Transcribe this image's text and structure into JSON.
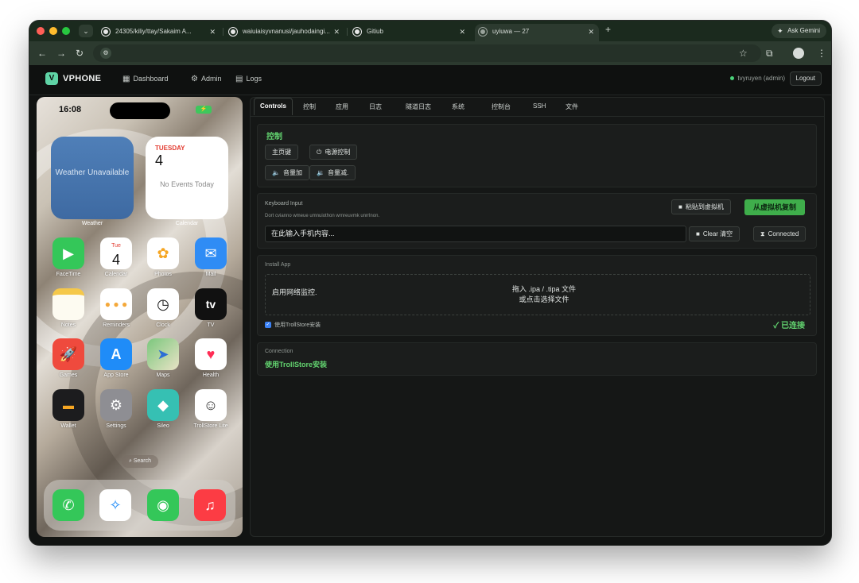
{
  "browser": {
    "tabs": [
      {
        "title": "24305/kiliy/ttay/Sakaim A..."
      },
      {
        "title": "waiuiaisyvnanusi/jauhodaingi..."
      },
      {
        "title": "Gitiub"
      },
      {
        "title": "uyiuwa — 27"
      }
    ],
    "new_tab": "+",
    "ask_gemini": "Ask Gemini"
  },
  "app": {
    "brand": "VPHONE",
    "nav": [
      {
        "label": "Dashboard",
        "icon": "dashboard-icon"
      },
      {
        "label": "Admin",
        "icon": "gear-icon"
      },
      {
        "label": "Logs",
        "icon": "document-icon"
      }
    ],
    "user": "tvyruyen (admin)",
    "logout": "Logout"
  },
  "phone": {
    "time": "16:08",
    "weather_widget": "Weather Unavailable",
    "weather_label": "Weather",
    "calendar_day": "TUESDAY",
    "calendar_date": "4",
    "calendar_events": "No Events Today",
    "calendar_label": "Calendar",
    "apps": [
      {
        "label": "FaceTime",
        "color": "#34c759"
      },
      {
        "label": "Calendar",
        "color": "#ffffff"
      },
      {
        "label": "Photos",
        "color": "#ffffff"
      },
      {
        "label": "Mail",
        "color": "#2f8cf5"
      },
      {
        "label": "Notes",
        "color": "#fdfbf1"
      },
      {
        "label": "Reminders",
        "color": "#ffffff"
      },
      {
        "label": "Clock",
        "color": "#ffffff"
      },
      {
        "label": "TV",
        "color": "#111111"
      },
      {
        "label": "Games",
        "color": "#ef4a3d"
      },
      {
        "label": "App Store",
        "color": "#1f8cf8"
      },
      {
        "label": "Maps",
        "color": "#7bc77d"
      },
      {
        "label": "Health",
        "color": "#ffffff"
      },
      {
        "label": "Wallet",
        "color": "#1c1c1e"
      },
      {
        "label": "Settings",
        "color": "#8e8e93"
      },
      {
        "label": "Sileo",
        "color": "#36c0b3"
      },
      {
        "label": "TrollStore Lite",
        "color": "#ffffff"
      }
    ],
    "calendar_icon_day": "Tue",
    "calendar_icon_date": "4",
    "tv_glyph": "tv",
    "search": "Search",
    "dock": [
      {
        "name": "phone",
        "color": "#34c759"
      },
      {
        "name": "safari",
        "color": "#ffffff"
      },
      {
        "name": "messages",
        "color": "#34c759"
      },
      {
        "name": "music",
        "color": "#fc3c44"
      }
    ]
  },
  "main": {
    "tabs": [
      "Controls",
      "控制",
      "应用",
      "日志",
      "隧道日志",
      "系统",
      "控制台",
      "SSH",
      "文件"
    ],
    "controls": {
      "title": "控制",
      "home_button": "主页键",
      "power_button": "电源控制",
      "volume_up": "音量加",
      "volume_down": "音量减."
    },
    "keyboard": {
      "title": "Keyboard Input",
      "subtitle": "Dort cvianno wmeue umnuiothon wrnreuvmk unrrlnon.",
      "paste_button": "粘贴到虚拟机",
      "copy_button": "从虚拟机复制",
      "input_placeholder": "在此输入手机内容...",
      "clear_button": "Clear 清空",
      "connected_button": "Connected"
    },
    "install": {
      "title": "Install App",
      "monitor": "启用网络监控.",
      "drop_line1": "拖入 .ipa / .tipa 文件",
      "drop_line2": "或点击选择文件",
      "checkbox_label": "使用TrollStore安装",
      "status": "已连接"
    },
    "connection": {
      "title": "Connection",
      "text": "使用TrollStore安装"
    }
  },
  "colors": {
    "accent_green": "#62d36f",
    "button_green": "#3fae4b",
    "tabstrip": "#1b2a1e"
  }
}
